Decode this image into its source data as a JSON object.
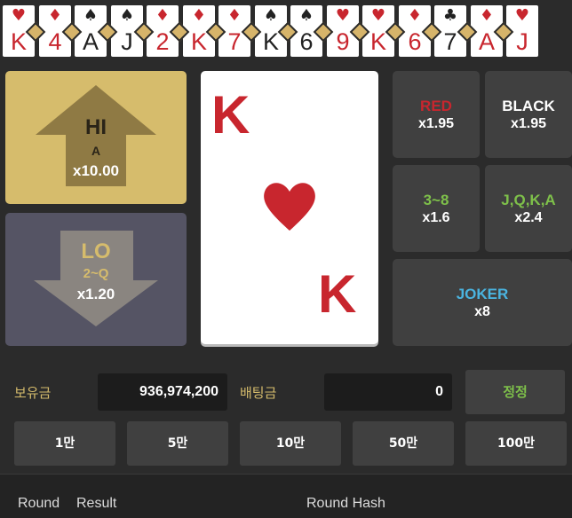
{
  "history": [
    {
      "rank": "K",
      "suit": "♥",
      "color": "red"
    },
    {
      "rank": "4",
      "suit": "♦",
      "color": "red"
    },
    {
      "rank": "A",
      "suit": "♠",
      "color": "black"
    },
    {
      "rank": "J",
      "suit": "♠",
      "color": "black"
    },
    {
      "rank": "2",
      "suit": "♦",
      "color": "red"
    },
    {
      "rank": "K",
      "suit": "♦",
      "color": "red"
    },
    {
      "rank": "7",
      "suit": "♦",
      "color": "red"
    },
    {
      "rank": "K",
      "suit": "♠",
      "color": "black"
    },
    {
      "rank": "6",
      "suit": "♠",
      "color": "black"
    },
    {
      "rank": "9",
      "suit": "♥",
      "color": "red"
    },
    {
      "rank": "K",
      "suit": "♥",
      "color": "red"
    },
    {
      "rank": "6",
      "suit": "♦",
      "color": "red"
    },
    {
      "rank": "7",
      "suit": "♣",
      "color": "black"
    },
    {
      "rank": "A",
      "suit": "♦",
      "color": "red"
    },
    {
      "rank": "J",
      "suit": "♥",
      "color": "red"
    }
  ],
  "hi": {
    "label": "HI",
    "range": "A",
    "odds": "x10.00"
  },
  "lo": {
    "label": "LO",
    "range": "2~Q",
    "odds": "x1.20"
  },
  "current_card": {
    "rank": "K",
    "suit": "heart-icon"
  },
  "bets": {
    "red": {
      "label": "RED",
      "odds": "x1.95"
    },
    "black": {
      "label": "BLACK",
      "odds": "x1.95"
    },
    "low_range": {
      "label": "3~8",
      "odds": "x1.6"
    },
    "faces": {
      "label": "J,Q,K,A",
      "odds": "x2.4"
    },
    "joker": {
      "label": "JOKER",
      "odds": "x8"
    }
  },
  "balance": {
    "label": "보유금",
    "value": "936,974,200"
  },
  "bet_amount": {
    "label": "배팅금",
    "value": "0"
  },
  "confirm_label": "정정",
  "chips": [
    "1만",
    "5만",
    "10만",
    "50만",
    "100만"
  ],
  "table_headers": {
    "round": "Round",
    "result": "Result",
    "hash": "Round Hash"
  },
  "colors": {
    "gold": "#d6bc6c",
    "red": "#c8262e",
    "green": "#7ec04a",
    "blue": "#4ab4e0",
    "panel": "#404040"
  }
}
